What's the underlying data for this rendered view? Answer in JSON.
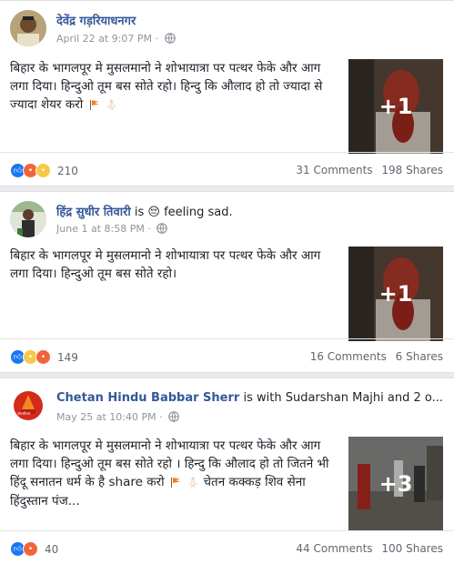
{
  "posts": [
    {
      "author": "देवेंद्र गड़रियाधनगर",
      "activity_text": "",
      "date": "April 22 at 9:07 PM",
      "dot": "·",
      "text": "बिहार के भागलपूर मे मुसलमानो ने शोभायात्रा पर पत्थर फेके और आग लगा दिया। हिन्दुओ तूम बस सोते रहो। हिन्दु कि औलाद हो तो ज्यादा से ज्यादा शेयर करो",
      "media_count": "+1",
      "reactions": [
        "like",
        "angry",
        "sad"
      ],
      "reaction_count": "210",
      "comments": "31 Comments",
      "shares": "198 Shares"
    },
    {
      "author": "हिंद्र सुधीर तिवारी",
      "activity_text": "is 😔 feeling sad.",
      "date": "June 1 at 8:58 PM",
      "dot": "·",
      "text": "बिहार के भागलपूर मे मुसलमानो ने शोभायात्रा पर पत्थर फेके और आग लगा दिया। हिन्दुओ तूम बस सोते रहो।",
      "media_count": "+1",
      "reactions": [
        "like",
        "sad",
        "angry"
      ],
      "reaction_count": "149",
      "comments": "16 Comments",
      "shares": "6 Shares"
    },
    {
      "author": "Chetan Hindu Babbar Sherr",
      "activity_text": "is with Sudarshan Majhi and 2 o...",
      "date": "May 25 at 10:40 PM",
      "dot": "·",
      "text": "बिहार के भागलपूर मे मुसलमानो ने शोभायात्रा पर पत्थर फेके और आग लगा दिया। हिन्दुओ तूम बस सोते रहो । हिन्दु कि औलाद हो तो जितने भी हिंदू सनातन धर्म के है share करो",
      "text_suffix": "चेतन कक्कड़ शिव सेना हिंदुस्तान पंज...",
      "media_count": "+3",
      "reactions": [
        "like",
        "angry"
      ],
      "reaction_count": "40",
      "comments": "44 Comments",
      "shares": "100 Shares"
    }
  ],
  "colors": {
    "name": "#365899",
    "meta": "#90949c",
    "like": "#1877f2",
    "angry": "#f0663a",
    "sad": "#f7c84a"
  },
  "icons": [
    "globe-icon",
    "flag-icon",
    "pray-icon",
    "like-icon",
    "angry-icon",
    "sad-icon"
  ],
  "avatar_badge": "जयश्रीराम"
}
